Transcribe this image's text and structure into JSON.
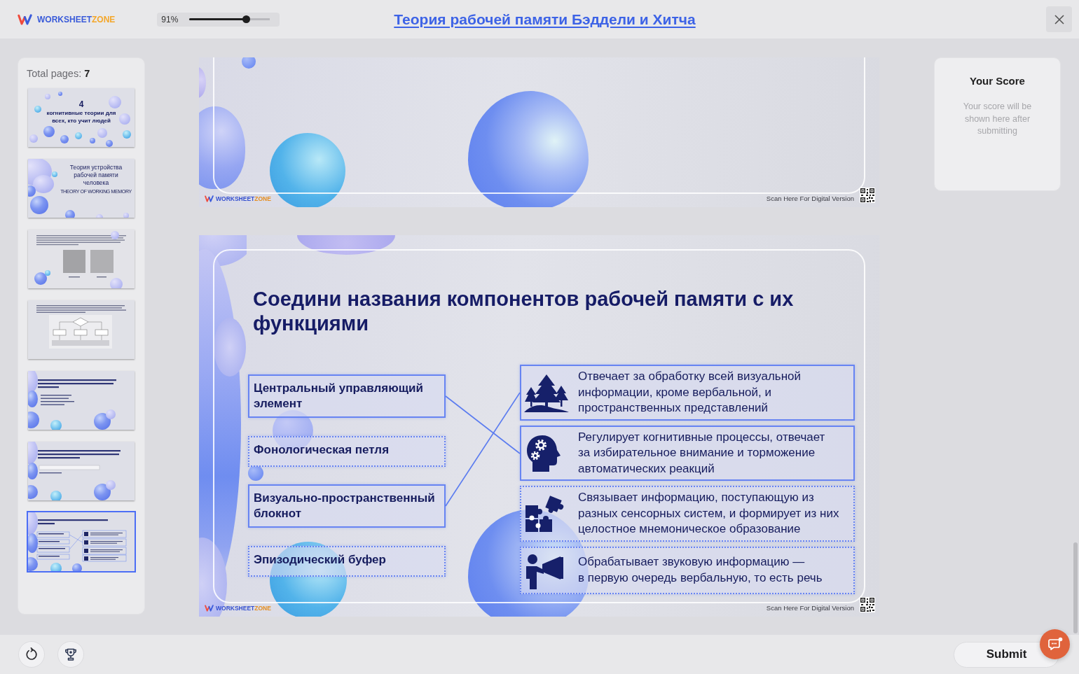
{
  "header": {
    "brand": {
      "main": "WORKSHEET",
      "accent": "ZONE"
    },
    "zoom": {
      "reading": "91%",
      "level": 0.71
    },
    "title": "Теория рабочей памяти Бэддели и Хитча"
  },
  "sidebar": {
    "total_label": "Total pages:",
    "total_count": "7",
    "thumbnails": [
      {
        "kind": "cover",
        "number": "4",
        "title": "когнитивные теории для всех, кто учит людей",
        "selected": false
      },
      {
        "kind": "title",
        "title": "Теория устройства рабочей памяти человека",
        "subtitle": "THEORY OF WORKING MEMORY",
        "selected": false
      },
      {
        "kind": "photos",
        "selected": false
      },
      {
        "kind": "diagram",
        "selected": false
      },
      {
        "kind": "choice",
        "selected": false
      },
      {
        "kind": "answer",
        "selected": false
      },
      {
        "kind": "matching",
        "selected": true
      }
    ]
  },
  "slides": [
    {
      "kind": "fragment",
      "footer": {
        "brand": {
          "main": "WORKSHEET",
          "accent": "ZONE"
        },
        "scan_text": "Scan Here For Digital Version"
      }
    },
    {
      "kind": "matching",
      "title": "Соедини названия компонентов рабочей памяти с их функциями",
      "components": [
        {
          "text": "Центральный управляющий элемент",
          "connected": true,
          "links": [
            false,
            true,
            false,
            false
          ]
        },
        {
          "text": "Фонологическая петля",
          "connected": false,
          "links": [
            false,
            false,
            false,
            false
          ]
        },
        {
          "text": "Визуально-пространственный блокнот",
          "connected": true,
          "links": [
            true,
            false,
            false,
            false
          ]
        },
        {
          "text": "Эпизодический буфер",
          "connected": false,
          "links": [
            false,
            false,
            false,
            false
          ]
        }
      ],
      "functions": [
        {
          "text": "Отвечает за обработку всей визуальной\nинформации, кроме вербальной, и\nпространственных представлений",
          "connected": true
        },
        {
          "text": "Регулирует когнитивные процессы, отвечает\nза избирательное внимание и торможение\nавтоматических реакций",
          "connected": true
        },
        {
          "text": "Связывает информацию, поступающую из\nразных сенсорных систем, и формирует из них\nцелостное мнемоническое образование",
          "connected": false
        },
        {
          "text": "Обрабатывает звуковую информацию —\nв первую очередь вербальную, то есть речь",
          "connected": false
        }
      ],
      "footer": {
        "brand": {
          "main": "WORKSHEET",
          "accent": "ZONE"
        },
        "scan_text": "Scan Here For Digital Version"
      }
    }
  ],
  "score": {
    "title": "Your Score",
    "message": "Your score will be shown here after submitting"
  },
  "footer": {
    "submit": "Submit"
  }
}
